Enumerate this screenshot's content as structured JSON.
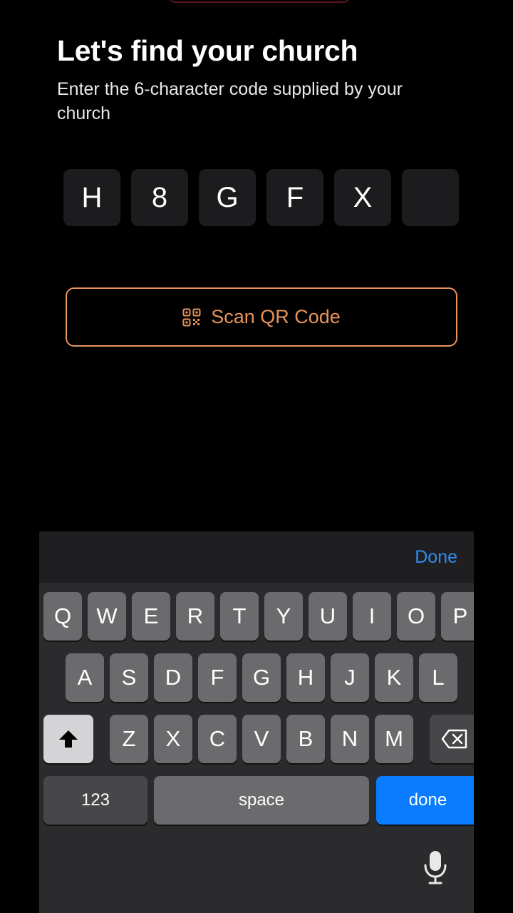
{
  "header": {
    "title": "Let's find your church",
    "subtitle": "Enter the 6-character code supplied by your church"
  },
  "code": {
    "chars": [
      "H",
      "8",
      "G",
      "F",
      "X",
      ""
    ]
  },
  "scan_button": {
    "icon": "qr-code-icon",
    "label": "Scan QR Code"
  },
  "keyboard": {
    "toolbar_done": "Done",
    "row1": [
      "Q",
      "W",
      "E",
      "R",
      "T",
      "Y",
      "U",
      "I",
      "O",
      "P"
    ],
    "row2": [
      "A",
      "S",
      "D",
      "F",
      "G",
      "H",
      "J",
      "K",
      "L"
    ],
    "row3": [
      "Z",
      "X",
      "C",
      "V",
      "B",
      "N",
      "M"
    ],
    "numbers_label": "123",
    "space_label": "space",
    "done_label": "done",
    "shift_icon": "shift-icon",
    "backspace_icon": "backspace-icon",
    "mic_icon": "microphone-icon"
  },
  "colors": {
    "accent": "#e8935a",
    "done_blue": "#0a7cff",
    "toolbar_done": "#2f8cf4"
  }
}
